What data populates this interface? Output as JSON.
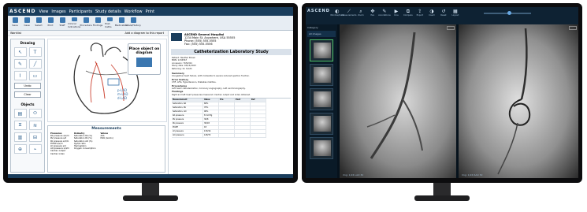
{
  "left_app": {
    "logo": "ASCEND",
    "menu": [
      "View",
      "Images",
      "Participants",
      "Study details",
      "Workflow",
      "Print"
    ],
    "ribbon": [
      "Save",
      "Case",
      "Select",
      "Print",
      "Staff",
      "Clinical Indications",
      "Procedure",
      "Findings",
      "Post-Caths",
      "Medication",
      "Vitals/History"
    ],
    "subheader_left": "Worklist",
    "subheader_mid": "Add a diagram to this report",
    "subheader_right": "Procedure report",
    "drawing_title": "Drawing",
    "objects_title": "Objects",
    "draw_buttons": [
      "Text",
      "Undo",
      "Clear",
      "Erase",
      "Save"
    ],
    "place_title": "Place object on diagram",
    "diagram_labels": [
      "p-LAD",
      "m-LAD",
      "d-LAD"
    ],
    "measurements_title": "Measurements",
    "meas_col1_header": "Pressures",
    "meas_col1": [
      "RA pressure a/v/m",
      "RV pressure s/d",
      "PA pressure s/d/m",
      "PCWP a/v/m",
      "LV pressure s/d",
      "AO pressure s/d/m",
      "Cardiac output",
      "Cardiac index"
    ],
    "meas_col2_header": "Oximetry",
    "meas_col2": [
      "Saturation RA (%)",
      "Saturation PA (%)",
      "Saturation AO (%)",
      "Qp/Qs ratio",
      "Hemoglobin",
      "Oxygen consumption"
    ],
    "meas_col3_header": "Valves",
    "meas_col3": [
      "AVA",
      "MVA (Gorlin)"
    ],
    "report_org": [
      "ASCEND General Hospital",
      "1234 Main St. Anywhere, USA 55555",
      "Phone: (555) 555-5555",
      "Fax: (555) 555-5556"
    ],
    "report_title": "Catheterization Laboratory Study",
    "report_fields": [
      "Patient: Heather Brown",
      "MRN: 1234567",
      "Accession: 7654321",
      "Study date: 03/15/2023",
      "Referring: Dr. Smith"
    ],
    "report_sections": [
      {
        "h": "Summary",
        "t": "Congestive heart failure, with moderate to severe reduced ejection fraction."
      },
      {
        "h": "Prior history",
        "t": "CHF, AFib, Hypertension, Diabetes mellitus."
      },
      {
        "h": "Procedures",
        "t": "Left heart catheterization, Coronary angiography, Left ventriculography."
      },
      {
        "h": "Findings",
        "t": "Right and left heart pressures measured. Cardiac output and index obtained."
      }
    ],
    "table_header": [
      "Measurement",
      "Value",
      "Pre",
      "Post",
      "Ref"
    ],
    "table_rows": [
      [
        "Saturation, RA",
        "68%",
        "",
        "",
        ""
      ],
      [
        "Saturation, PA",
        "70%",
        "",
        "",
        ""
      ],
      [
        "Saturation, AO",
        "96%",
        "",
        "",
        ""
      ],
      [
        "RA pressure",
        "8 mmHg",
        "",
        "",
        ""
      ],
      [
        "RV pressure",
        "36/8",
        "",
        "",
        ""
      ],
      [
        "PA pressure",
        "36/18",
        "",
        "",
        ""
      ],
      [
        "PCWP",
        "18",
        "",
        "",
        ""
      ],
      [
        "LV pressure",
        "130/14",
        "",
        "",
        ""
      ],
      [
        "AO pressure",
        "128/72",
        "",
        "",
        ""
      ]
    ]
  },
  "right_app": {
    "logo": "ASCEND",
    "tools": [
      "Window/level",
      "Measurements",
      "Zoom",
      "Pan",
      "Annotations",
      "Cine",
      "Compare",
      "Export",
      "Invert",
      "Reset",
      "Layout",
      "Current images"
    ],
    "category_label": "Category",
    "category_value": "All images",
    "viewport1_text": "Img: 1/24  LAO 30",
    "viewport2_text": "Img: 1/24  RAO 30"
  }
}
